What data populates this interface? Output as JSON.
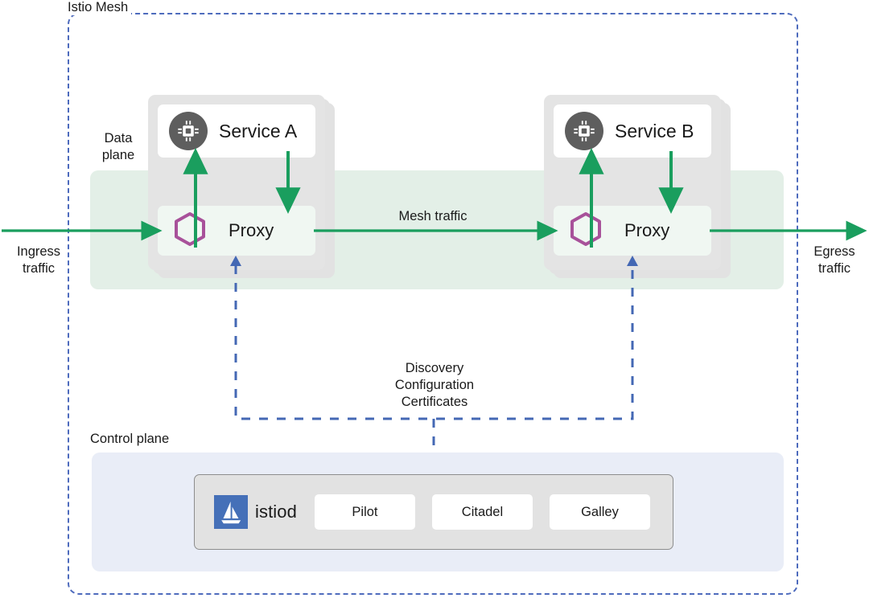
{
  "diagram": {
    "title": "Istio Mesh",
    "mesh_label": "Istio Mesh",
    "data_plane_label": "Data\nplane",
    "control_plane_label": "Control plane"
  },
  "colors": {
    "mesh_border": "#4e6bbd",
    "data_plane_band": "#e3efe7",
    "control_plane_band": "#e9edf7",
    "traffic_arrow": "#1a9e5e",
    "config_arrow": "#4e6bbd",
    "proxy_hex": "#a8519a",
    "service_icon_bg": "#5e5e5e",
    "istiod_logo_bg": "#4570b8",
    "pod_bg": "#e2e2e2"
  },
  "pods": [
    {
      "id": "pod-a",
      "service": {
        "name": "Service A",
        "icon": "cpu-chip-icon"
      },
      "proxy": {
        "name": "Proxy",
        "icon": "hexagon-icon"
      }
    },
    {
      "id": "pod-b",
      "service": {
        "name": "Service B",
        "icon": "cpu-chip-icon"
      },
      "proxy": {
        "name": "Proxy",
        "icon": "hexagon-icon"
      }
    }
  ],
  "edges": {
    "ingress": "Ingress\ntraffic",
    "egress": "Egress\ntraffic",
    "mesh_traffic": "Mesh traffic",
    "discovery": "Discovery\nConfiguration\nCertificates"
  },
  "control_plane": {
    "istiod_label": "istiod",
    "istiod_logo": "sailboat-icon",
    "components": [
      {
        "label": "Pilot"
      },
      {
        "label": "Citadel"
      },
      {
        "label": "Galley"
      }
    ]
  }
}
